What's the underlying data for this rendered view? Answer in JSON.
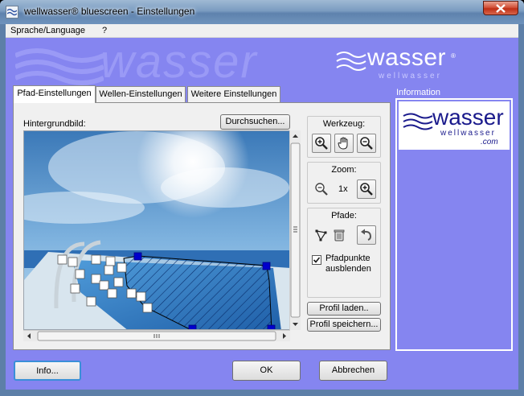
{
  "window": {
    "title": "wellwasser® bluescreen - Einstellungen",
    "close_icon": "close-icon"
  },
  "menu": [
    "Sprache/Language",
    "?"
  ],
  "branding": {
    "watermark": "wasser",
    "brand": "wasser",
    "registered": "®",
    "sub": "wellwasser",
    "domain": ".com"
  },
  "tabs": [
    {
      "label": "Pfad-Einstellungen",
      "active": true
    },
    {
      "label": "Wellen-Einstellungen",
      "active": false
    },
    {
      "label": "Weitere Einstellungen",
      "active": false
    }
  ],
  "path_settings": {
    "background_label": "Hintergrundbild:",
    "browse_button": "Durchsuchen...",
    "tool_group": {
      "title": "Werkzeug:",
      "icons": [
        "zoom-in-icon",
        "hand-pan-icon",
        "zoom-out-icon"
      ]
    },
    "zoom_group": {
      "title": "Zoom:",
      "value": "1x",
      "icons": [
        "zoom-out-icon",
        "zoom-in-icon"
      ]
    },
    "paths_group": {
      "title": "Pfade:",
      "icons": [
        "add-path-icon",
        "trash-icon",
        "undo-icon"
      ]
    },
    "hide_points": {
      "label_line1": "Pfadpunkte",
      "label_line2": "ausblenden",
      "checked": true
    },
    "load_profile_button": "Profil laden..",
    "save_profile_button": "Profil speichern..."
  },
  "information": {
    "label": "Information"
  },
  "footer": {
    "info_button": "Info...",
    "ok_button": "OK",
    "cancel_button": "Abbrechen"
  },
  "colors": {
    "client_background": "#8585f0",
    "path_handle": "#0000cc",
    "path_fill": "#3a6fd0"
  }
}
